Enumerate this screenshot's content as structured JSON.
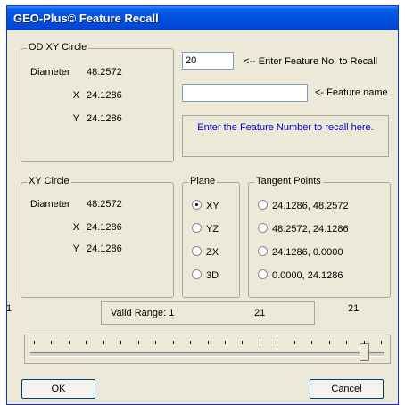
{
  "window": {
    "title": "GEO-Plus© Feature Recall"
  },
  "od_circle": {
    "label": "OD XY Circle",
    "diameter_label": "Diameter",
    "diameter": "48.2572",
    "x_label": "X",
    "x": "24.1286",
    "y_label": "Y",
    "y": "24.1286"
  },
  "feature_no": {
    "value": "20",
    "hint": "<-- Enter Feature No. to Recall"
  },
  "feature_name": {
    "value": "",
    "hint": "<- Feature name"
  },
  "instruction": "Enter the Feature Number to recall here.",
  "xy_circle": {
    "label": "XY Circle",
    "diameter_label": "Diameter",
    "diameter": "48.2572",
    "x_label": "X",
    "x": "24.1286",
    "y_label": "Y",
    "y": "24.1286"
  },
  "plane": {
    "label": "Plane",
    "options": [
      "XY",
      "YZ",
      "ZX",
      "3D"
    ],
    "selected": "XY"
  },
  "tangent": {
    "label": "Tangent Points",
    "options": [
      "24.1286, 48.2572",
      "48.2572, 24.1286",
      "24.1286, 0.0000",
      "0.0000, 24.1286"
    ]
  },
  "range": {
    "min_label": "1",
    "max_label": "21",
    "valid_label": "Valid Range: 1",
    "valid_max": "21"
  },
  "slider": {
    "min": 1,
    "max": 21,
    "value": 20
  },
  "buttons": {
    "ok": "OK",
    "cancel": "Cancel"
  }
}
